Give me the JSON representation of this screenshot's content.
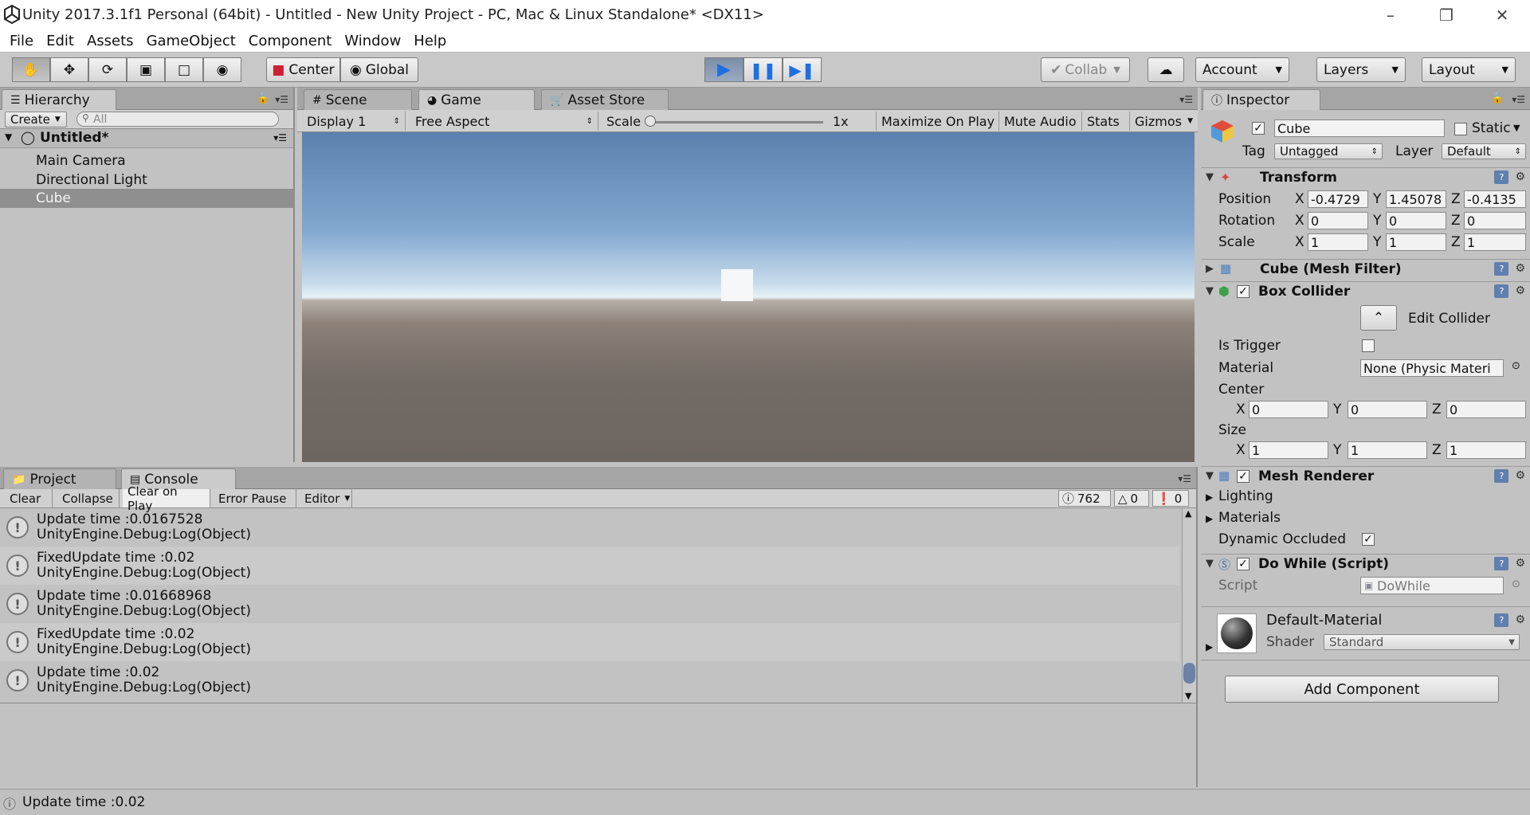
{
  "window": {
    "title": "Unity 2017.3.1f1 Personal (64bit) - Untitled - New Unity Project - PC, Mac & Linux Standalone* <DX11>"
  },
  "menu": [
    "File",
    "Edit",
    "Assets",
    "GameObject",
    "Component",
    "Window",
    "Help"
  ],
  "toolbar": {
    "pivot": "Center",
    "space": "Global",
    "collab": "Collab",
    "account": "Account",
    "layers": "Layers",
    "layout": "Layout"
  },
  "hierarchy": {
    "tab": "Hierarchy",
    "create": "Create",
    "search_placeholder": "All",
    "scene": "Untitled*",
    "items": [
      "Main Camera",
      "Directional Light",
      "Cube"
    ]
  },
  "game": {
    "tabs": [
      "Scene",
      "Game",
      "Asset Store"
    ],
    "display": "Display 1",
    "aspect": "Free Aspect",
    "scale_label": "Scale",
    "scale_value": "1x",
    "maximize": "Maximize On Play",
    "mute": "Mute Audio",
    "stats": "Stats",
    "gizmos": "Gizmos"
  },
  "console": {
    "tabs": [
      "Project",
      "Console"
    ],
    "buttons": [
      "Clear",
      "Collapse",
      "Clear on Play",
      "Error Pause",
      "Editor"
    ],
    "counts": {
      "logs": "762",
      "warnings": "0",
      "errors": "0"
    },
    "entries": [
      {
        "line1": "Update time :0.0167528",
        "line2": "UnityEngine.Debug:Log(Object)"
      },
      {
        "line1": "FixedUpdate time :0.02",
        "line2": "UnityEngine.Debug:Log(Object)"
      },
      {
        "line1": "Update time :0.01668968",
        "line2": "UnityEngine.Debug:Log(Object)"
      },
      {
        "line1": "FixedUpdate time :0.02",
        "line2": "UnityEngine.Debug:Log(Object)"
      },
      {
        "line1": "Update time :0.02",
        "line2": "UnityEngine.Debug:Log(Object)"
      }
    ],
    "status": "Update time :0.02"
  },
  "inspector": {
    "tab": "Inspector",
    "object_name": "Cube",
    "static": "Static",
    "tag_label": "Tag",
    "tag": "Untagged",
    "layer_label": "Layer",
    "layer": "Default",
    "transform": {
      "title": "Transform",
      "position_label": "Position",
      "rotation_label": "Rotation",
      "scale_label": "Scale",
      "position": {
        "x": "-0.4729",
        "y": "1.45078",
        "z": "-0.4135"
      },
      "rotation": {
        "x": "0",
        "y": "0",
        "z": "0"
      },
      "scale": {
        "x": "1",
        "y": "1",
        "z": "1"
      }
    },
    "mesh_filter": "Cube (Mesh Filter)",
    "box_collider": {
      "title": "Box Collider",
      "edit": "Edit Collider",
      "is_trigger": "Is Trigger",
      "material_label": "Material",
      "material": "None (Physic Materi",
      "center_label": "Center",
      "center": {
        "x": "0",
        "y": "0",
        "z": "0"
      },
      "size_label": "Size",
      "size": {
        "x": "1",
        "y": "1",
        "z": "1"
      }
    },
    "mesh_renderer": {
      "title": "Mesh Renderer",
      "lighting": "Lighting",
      "materials": "Materials",
      "dynamic_occluded": "Dynamic Occluded"
    },
    "script": {
      "title": "Do While (Script)",
      "label": "Script",
      "value": "DoWhile"
    },
    "material": {
      "name": "Default-Material",
      "shader_label": "Shader",
      "shader": "Standard"
    },
    "add_component": "Add Component"
  },
  "axis_letters": {
    "x": "X",
    "y": "Y",
    "z": "Z"
  }
}
